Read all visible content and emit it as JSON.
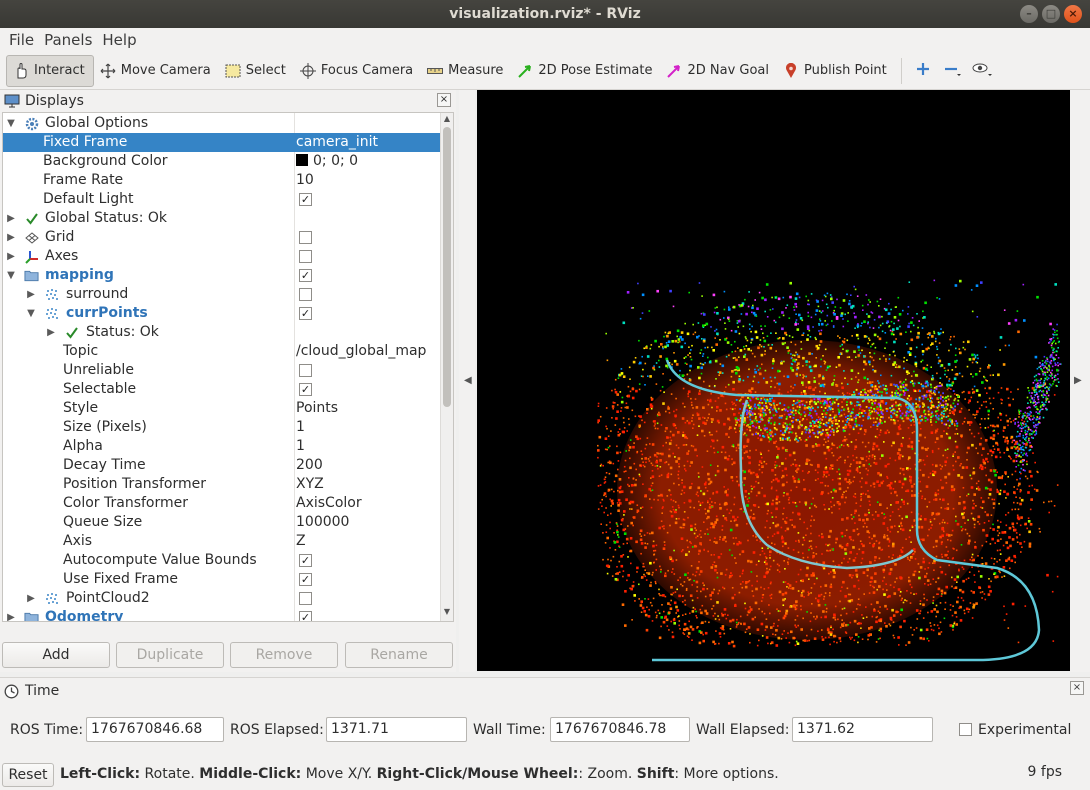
{
  "window": {
    "title": "visualization.rviz* - RViz"
  },
  "menu": {
    "file": "File",
    "panels": "Panels",
    "help": "Help"
  },
  "toolbar": {
    "interact": "Interact",
    "move_camera": "Move Camera",
    "select": "Select",
    "focus_camera": "Focus Camera",
    "measure": "Measure",
    "pose_estimate": "2D Pose Estimate",
    "nav_goal": "2D Nav Goal",
    "publish_point": "Publish Point"
  },
  "displays": {
    "title": "Displays",
    "rows": [
      {
        "name": "Global Options",
        "value": ""
      },
      {
        "name": "Fixed Frame",
        "value": "camera_init"
      },
      {
        "name": "Background Color",
        "value": "0; 0; 0"
      },
      {
        "name": "Frame Rate",
        "value": "10"
      },
      {
        "name": "Default Light",
        "value": ""
      },
      {
        "name": "Global Status: Ok",
        "value": ""
      },
      {
        "name": "Grid",
        "value": ""
      },
      {
        "name": "Axes",
        "value": ""
      },
      {
        "name": "mapping",
        "value": ""
      },
      {
        "name": "surround",
        "value": ""
      },
      {
        "name": "currPoints",
        "value": ""
      },
      {
        "name": "Status: Ok",
        "value": ""
      },
      {
        "name": "Topic",
        "value": "/cloud_global_map"
      },
      {
        "name": "Unreliable",
        "value": ""
      },
      {
        "name": "Selectable",
        "value": ""
      },
      {
        "name": "Style",
        "value": "Points"
      },
      {
        "name": "Size (Pixels)",
        "value": "1"
      },
      {
        "name": "Alpha",
        "value": "1"
      },
      {
        "name": "Decay Time",
        "value": "200"
      },
      {
        "name": "Position Transformer",
        "value": "XYZ"
      },
      {
        "name": "Color Transformer",
        "value": "AxisColor"
      },
      {
        "name": "Queue Size",
        "value": "100000"
      },
      {
        "name": "Axis",
        "value": "Z"
      },
      {
        "name": "Autocompute Value Bounds",
        "value": ""
      },
      {
        "name": "Use Fixed Frame",
        "value": ""
      },
      {
        "name": "PointCloud2",
        "value": ""
      },
      {
        "name": "Odometry",
        "value": ""
      }
    ],
    "buttons": {
      "add": "Add",
      "duplicate": "Duplicate",
      "remove": "Remove",
      "rename": "Rename"
    }
  },
  "time": {
    "title": "Time",
    "ros_time_label": "ROS Time:",
    "ros_time": "1767670846.68",
    "ros_elapsed_label": "ROS Elapsed:",
    "ros_elapsed": "1371.71",
    "wall_time_label": "Wall Time:",
    "wall_time": "1767670846.78",
    "wall_elapsed_label": "Wall Elapsed:",
    "wall_elapsed": "1371.62",
    "experimental_label": "Experimental"
  },
  "status": {
    "reset": "Reset",
    "left_click": "Left-Click:",
    "left_action": " Rotate. ",
    "middle_click": "Middle-Click:",
    "middle_action": " Move X/Y. ",
    "right_click": "Right-Click/Mouse Wheel:",
    "right_action": ": Zoom. ",
    "shift": "Shift",
    "shift_action": ": More options.",
    "fps": "9 fps"
  },
  "colors": {
    "selection": "#3584c6",
    "accent_blue": "#2f74b8",
    "trajectory": "#5ec8d8"
  }
}
